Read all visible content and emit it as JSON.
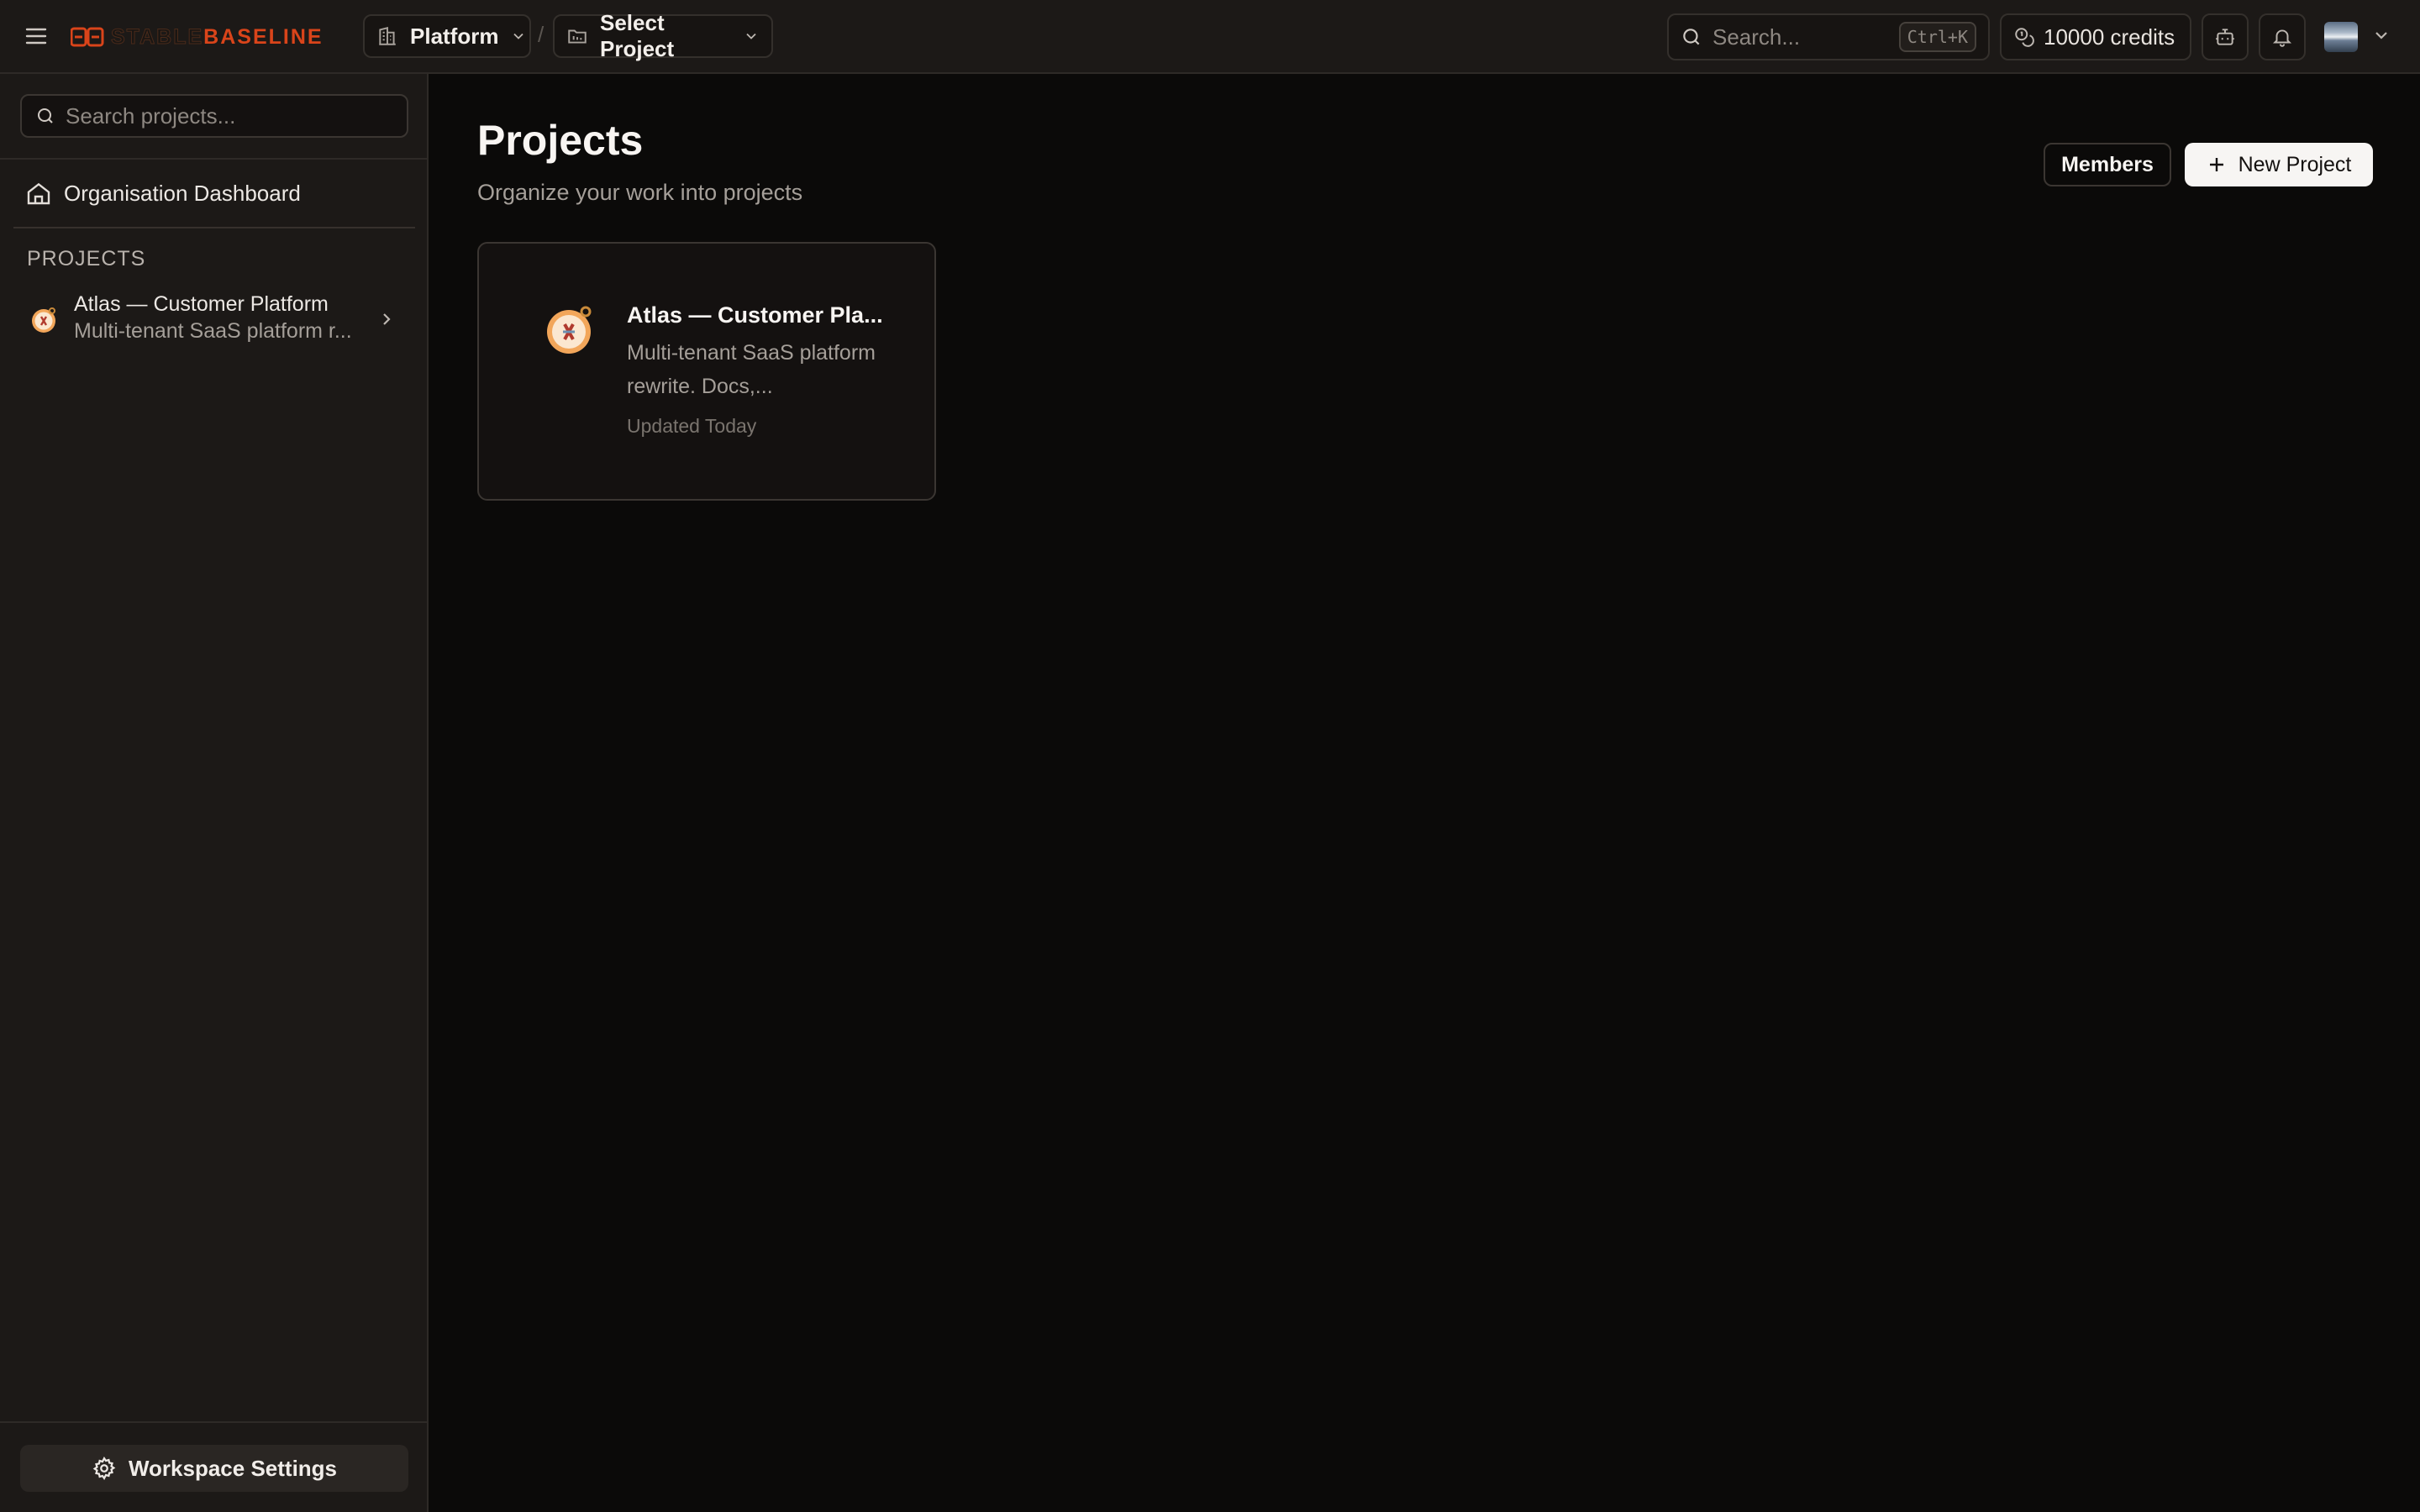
{
  "header": {
    "logo_text_a": "STABLE",
    "logo_text_b": "BASELINE",
    "workspace_label": "Platform",
    "project_select_label": "Select Project",
    "breadcrumb_separator": "/",
    "search_placeholder": "Search...",
    "search_shortcut": "Ctrl+K",
    "credits_label": "10000 credits"
  },
  "sidebar": {
    "search_placeholder": "Search projects...",
    "org_dashboard_label": "Organisation Dashboard",
    "projects_heading": "PROJECTS",
    "projects": [
      {
        "title": "Atlas — Customer Platform",
        "description": "Multi-tenant SaaS platform r...",
        "icon": "compass-emoji"
      }
    ],
    "workspace_settings_label": "Workspace Settings"
  },
  "main": {
    "title": "Projects",
    "subtitle": "Organize your work into projects",
    "members_button": "Members",
    "new_project_button": "New Project",
    "cards": [
      {
        "title": "Atlas — Customer Pla...",
        "description": "Multi-tenant SaaS platform rewrite. Docs,...",
        "updated": "Updated Today",
        "icon": "compass-emoji"
      }
    ]
  },
  "colors": {
    "brand_accent": "#d9441a",
    "background": "#0b0a09",
    "panel": "#1c1917"
  }
}
